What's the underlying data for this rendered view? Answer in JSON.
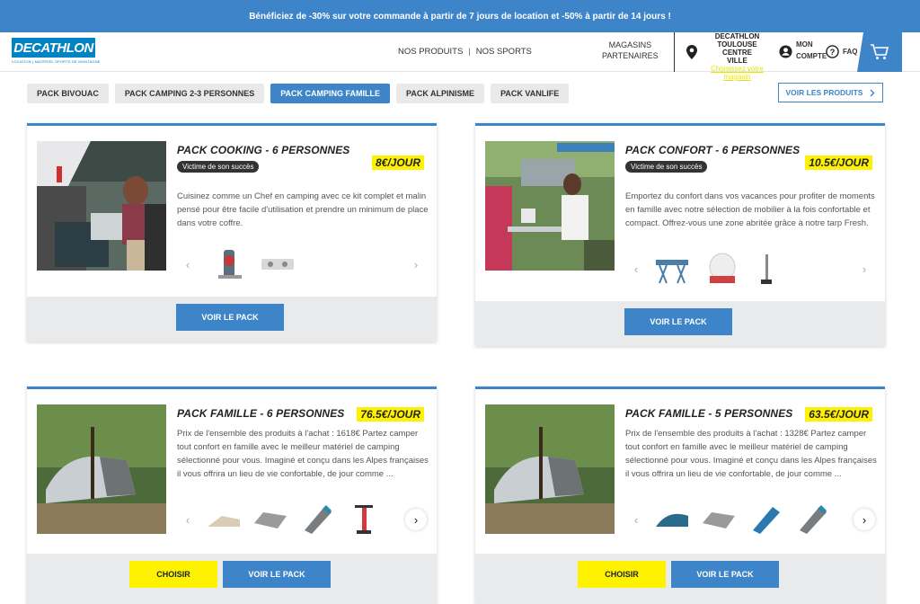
{
  "promo": "Bénéficiez de -30% sur votre commande à partir de 7 jours de location et -50% à partir de 14 jours !",
  "header": {
    "logo": "DECATHLON",
    "logo_tagline": "LOCATION | MATÉRIEL SPORTS DE MONTAGNE",
    "nav": [
      "NOS PRODUITS",
      "NOS SPORTS"
    ],
    "nav_sep": "|",
    "magasins": [
      "MAGASINS",
      "PARTENAIRES"
    ],
    "store_name": [
      "DECATHLON",
      "TOULOUSE CENTRE",
      "VILLE"
    ],
    "store_choose": [
      "Choisissez votre",
      "magasin"
    ],
    "account": [
      "MON",
      "COMPTE"
    ],
    "faq": "FAQ"
  },
  "tabs": [
    {
      "label": "PACK BIVOUAC",
      "active": false
    },
    {
      "label": "PACK CAMPING 2-3 PERSONNES",
      "active": false
    },
    {
      "label": "PACK CAMPING FAMILLE",
      "active": true
    },
    {
      "label": "PACK ALPINISME",
      "active": false
    },
    {
      "label": "PACK VANLIFE",
      "active": false
    }
  ],
  "see_products": "VOIR LES PRODUITS",
  "cards": [
    {
      "title": "PACK COOKING - 6 PERSONNES",
      "price": "8€/JOUR",
      "badge": "Victime de son succès",
      "desc": "Cuisinez comme un Chef en camping avec ce kit complet et malin pensé pour être facile d'utilisation et prendre un minimum de place dans votre coffre.",
      "products": [
        "cookware-stack",
        "camping-stove"
      ],
      "choose": null,
      "see_pack": "VOIR LE PACK"
    },
    {
      "title": "PACK CONFORT - 6 PERSONNES",
      "price": "10.5€/JOUR",
      "badge": "Victime de son succès",
      "desc": "Emportez du confort dans vos vacances pour profiter de moments en famille avec notre sélection de mobilier à la fois confortable et compact. Offrez-vous une zone abritée grâce à notre tarp Fresh.",
      "products": [
        "folding-table",
        "cooler-box",
        "tarp-pole"
      ],
      "choose": null,
      "see_pack": "VOIR LE PACK"
    },
    {
      "title": "PACK FAMILLE - 6 PERSONNES",
      "price": "76.5€/JOUR",
      "badge": null,
      "desc": "Prix de l'ensemble des produits à l'achat : 1618€ Partez camper tout confort en famille avec le meilleur matériel de camping sélectionné pour vous. Imaginé et conçu dans les Alpes françaises il vous offrira un lieu de vie confortable, de jour comme ...",
      "products": [
        "tent",
        "air-mattress",
        "sleeping-bag",
        "pump"
      ],
      "choose": "CHOISIR",
      "see_pack": "VOIR LE PACK"
    },
    {
      "title": "PACK FAMILLE - 5 PERSONNES",
      "price": "63.5€/JOUR",
      "badge": null,
      "desc": "Prix de l'ensemble des produits à l'achat : 1328€ Partez camper tout confort en famille avec le meilleur matériel de camping sélectionné pour vous. Imaginé et conçu dans les Alpes françaises il vous offrira un lieu de vie confortable, de jour comme ...",
      "products": [
        "tent",
        "air-mattress",
        "sleeping-mat",
        "sleeping-bag"
      ],
      "choose": "CHOISIR",
      "see_pack": "VOIR LE PACK"
    }
  ],
  "colors": {
    "brand": "#3e84c9",
    "yellow": "#fff200",
    "logo_blue": "#0082c3"
  }
}
